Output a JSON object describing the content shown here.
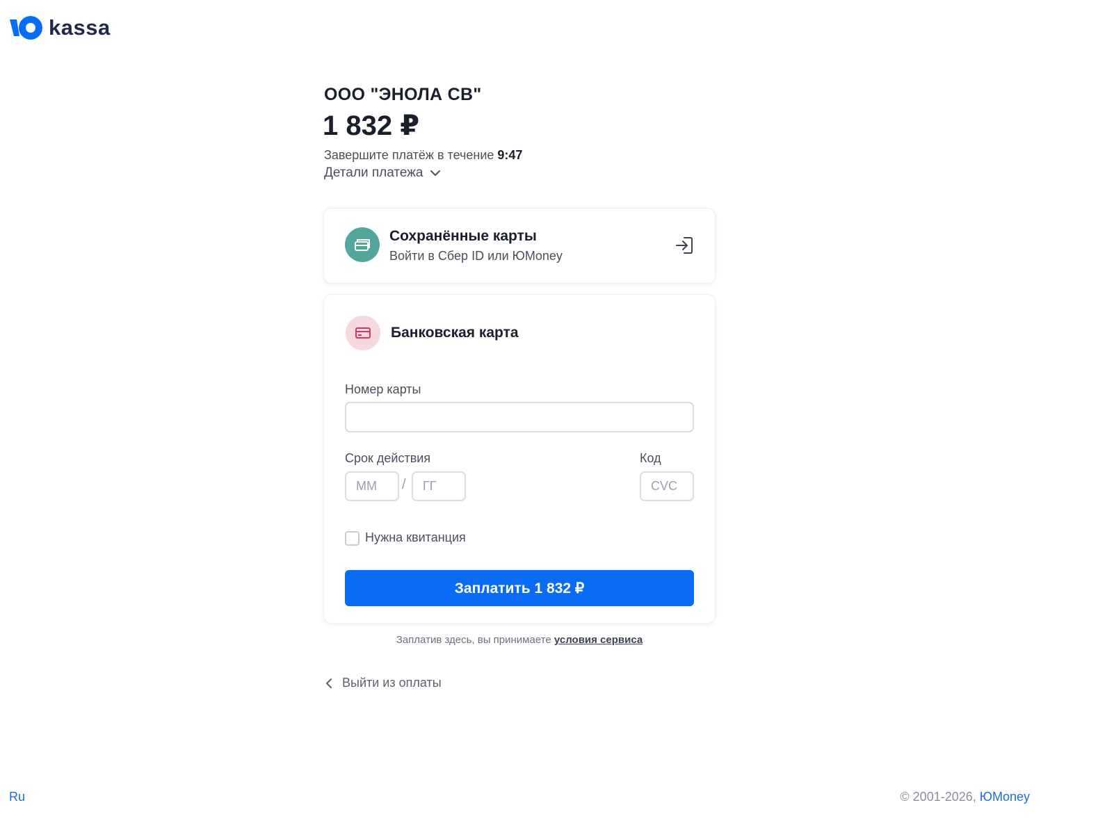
{
  "brand": {
    "logo_text": "kassa",
    "accent": "#0a6cf5"
  },
  "header": {
    "merchant": "ООО \"ЭНОЛА СВ\"",
    "amount": "1 832 ₽",
    "timer_prefix": "Завершите платёж в течение",
    "timer_value": "9:47",
    "details_label": "Детали платежа"
  },
  "saved_cards": {
    "title": "Сохранённые карты",
    "subtitle": "Войти в Сбер ID или ЮMoney",
    "icon": "wallet-icon",
    "action_icon": "login-icon"
  },
  "bank_card": {
    "title": "Банковская карта",
    "icon": "credit-card-icon",
    "card_number_label": "Номер карты",
    "card_number_value": "",
    "expiry_label": "Срок действия",
    "month_placeholder": "ММ",
    "year_placeholder": "ГГ",
    "separator": "/",
    "code_label": "Код",
    "cvc_placeholder": "CVC",
    "receipt_label": "Нужна квитанция",
    "receipt_checked": false,
    "pay_button": "Заплатить 1 832 ₽"
  },
  "terms": {
    "prefix": "Заплатив здесь, вы принимаете",
    "link": "условия сервиса"
  },
  "exit_label": "Выйти из оплаты",
  "footer": {
    "language": "Ru",
    "copyright": "© 2001-2026,",
    "company": "ЮMoney"
  }
}
